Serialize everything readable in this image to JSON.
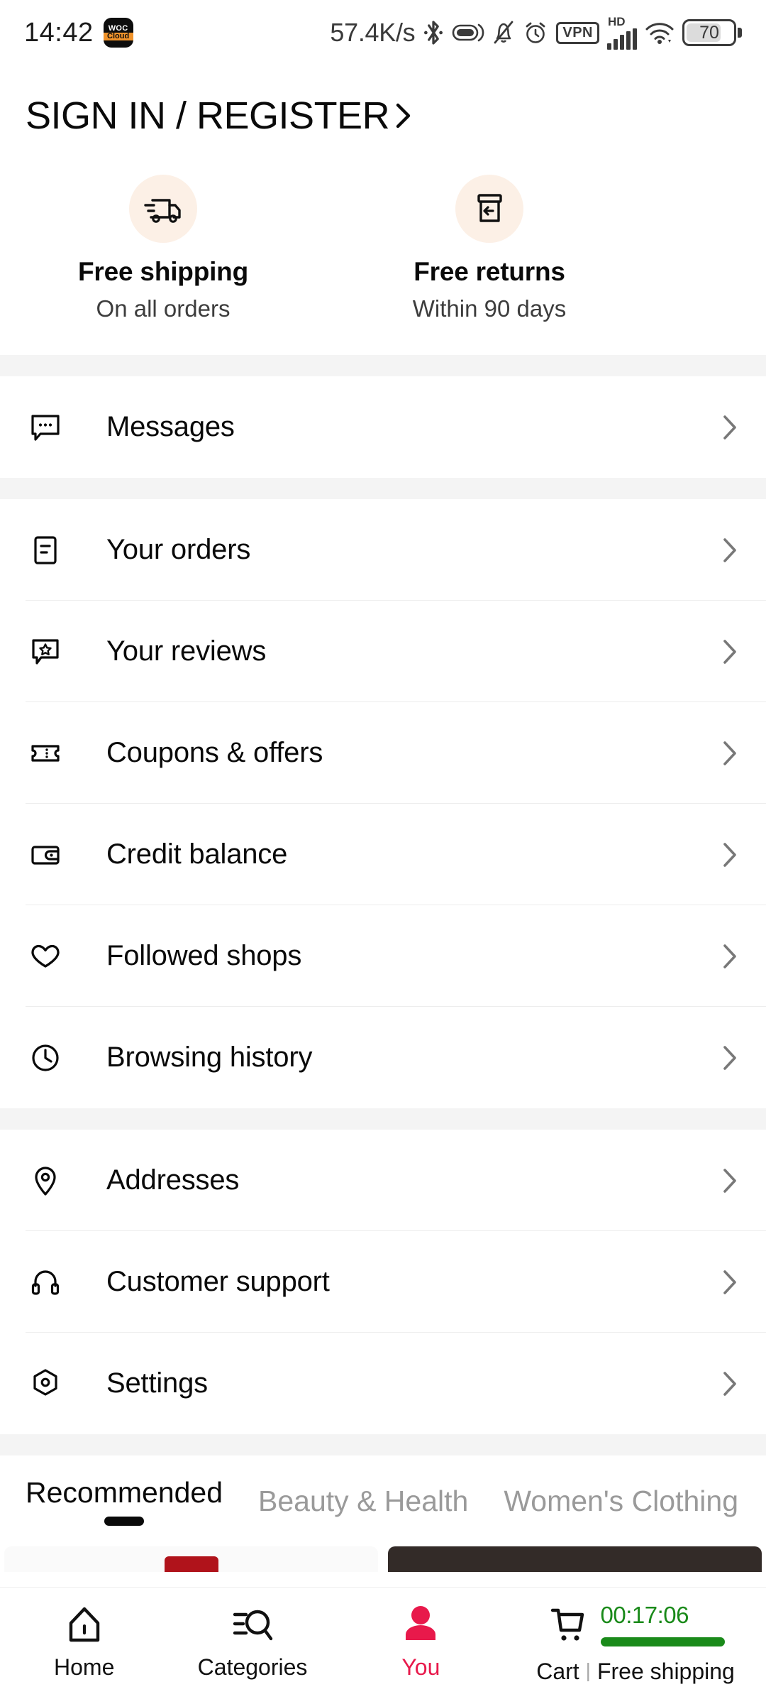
{
  "status_bar": {
    "time": "14:42",
    "app_badge": {
      "top": "WOC",
      "bottom": "Cloud"
    },
    "network_speed": "57.4K/s",
    "icons": [
      "bluetooth-icon",
      "data-saver-icon",
      "notification-muted-icon",
      "alarm-icon"
    ],
    "vpn_label": "VPN",
    "hd_label": "HD",
    "signal_icon": "cellular-signal-icon",
    "wifi_icon": "wifi-icon",
    "battery_level": "70"
  },
  "header": {
    "sign_in_label": "SIGN IN / REGISTER",
    "chevron_icon": "chevron-right-icon"
  },
  "benefits": [
    {
      "icon": "shipping-truck-icon",
      "title": "Free shipping",
      "subtitle": "On all orders"
    },
    {
      "icon": "return-box-icon",
      "title": "Free returns",
      "subtitle": "Within 90 days"
    }
  ],
  "menu_groups": [
    {
      "items": [
        {
          "icon": "message-bubble-icon",
          "label": "Messages"
        }
      ]
    },
    {
      "items": [
        {
          "icon": "order-document-icon",
          "label": "Your orders"
        },
        {
          "icon": "review-star-bubble-icon",
          "label": "Your reviews"
        },
        {
          "icon": "coupon-ticket-icon",
          "label": "Coupons & offers"
        },
        {
          "icon": "wallet-icon",
          "label": "Credit balance"
        },
        {
          "icon": "heart-icon",
          "label": "Followed shops"
        },
        {
          "icon": "clock-history-icon",
          "label": "Browsing history"
        }
      ]
    },
    {
      "items": [
        {
          "icon": "location-pin-icon",
          "label": "Addresses"
        },
        {
          "icon": "headset-icon",
          "label": "Customer support"
        },
        {
          "icon": "settings-hexagon-icon",
          "label": "Settings"
        }
      ]
    }
  ],
  "row_chevron_icon": "chevron-right-icon",
  "feed_tabs": [
    {
      "label": "Recommended",
      "active": true
    },
    {
      "label": "Beauty & Health",
      "active": false
    },
    {
      "label": "Women's Clothing",
      "active": false
    }
  ],
  "bottom_nav": {
    "items": [
      {
        "icon": "home-icon",
        "label": "Home",
        "active": false
      },
      {
        "icon": "categories-search-icon",
        "label": "Categories",
        "active": false
      },
      {
        "icon": "user-person-icon",
        "label": "You",
        "active": true
      }
    ],
    "cart": {
      "icon": "shopping-cart-icon",
      "timer": "00:17:06",
      "label": "Cart",
      "separator": "|",
      "promo": "Free shipping"
    }
  },
  "colors": {
    "accent_pink": "#e8194b",
    "timer_green": "#1a8a1a",
    "benefit_circle": "#fcf0e6",
    "band_grey": "#f4f4f4",
    "muted_text": "#9a9a9a"
  }
}
